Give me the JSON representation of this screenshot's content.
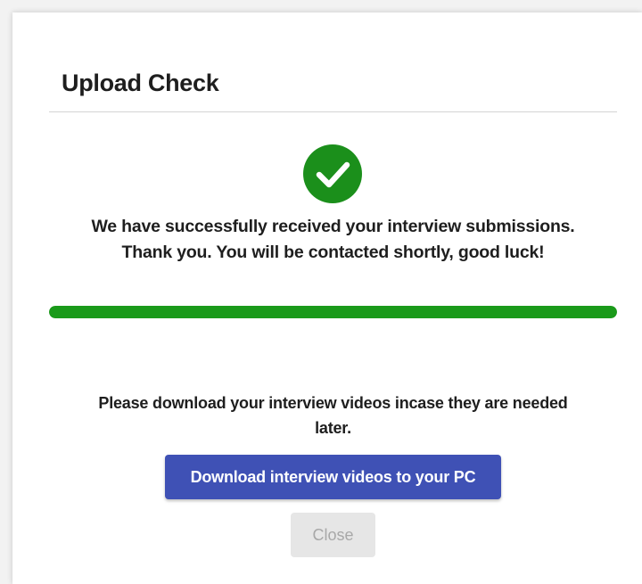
{
  "dialog": {
    "title": "Upload Check",
    "success_icon": "check-circle-icon",
    "message_line1": "We have successfully received your interview submissions.",
    "message_line2": "Thank you. You will be contacted shortly, good luck!",
    "progress_percent": 100,
    "download_note": "Please download your interview videos incase they are needed later.",
    "download_button_label": "Download interview videos to your PC",
    "close_button_label": "Close"
  },
  "colors": {
    "success_green": "#1b8f1b",
    "progress_green": "#1a9a1a",
    "primary_button": "#3f51b5",
    "disabled_button_bg": "#e6e6e6",
    "disabled_button_text": "#a8a8a8"
  }
}
